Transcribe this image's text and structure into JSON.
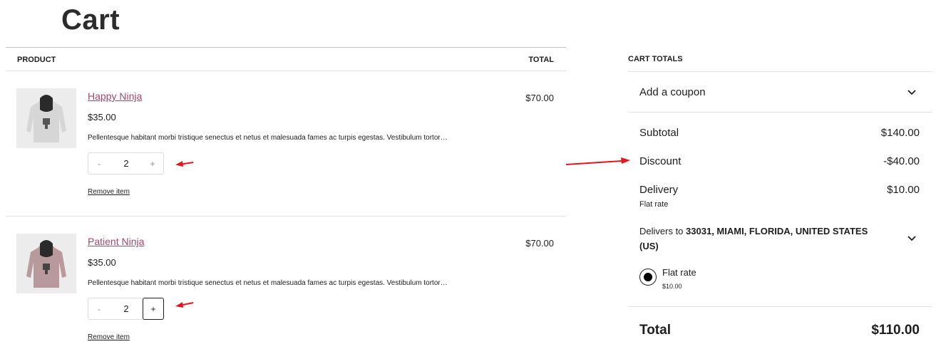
{
  "page": {
    "title": "Cart"
  },
  "cart_table": {
    "header_product": "PRODUCT",
    "header_total": "TOTAL",
    "items": [
      {
        "name": "Happy Ninja",
        "price": "$35.00",
        "description": "Pellentesque habitant morbi tristique senectus et netus et malesuada fames ac turpis egestas. Vestibulum tortor…",
        "quantity": "2",
        "minus_label": "-",
        "plus_label": "+",
        "line_total": "$70.00",
        "remove_label": "Remove item",
        "image_color": "#d6d6d6"
      },
      {
        "name": "Patient Ninja",
        "price": "$35.00",
        "description": "Pellentesque habitant morbi tristique senectus et netus et malesuada fames ac turpis egestas. Vestibulum tortor…",
        "quantity": "2",
        "minus_label": "-",
        "plus_label": "+",
        "line_total": "$70.00",
        "remove_label": "Remove item",
        "image_color": "#b89a9c"
      }
    ]
  },
  "cart_totals": {
    "heading": "CART TOTALS",
    "coupon_label": "Add a coupon",
    "subtotal_label": "Subtotal",
    "subtotal_value": "$140.00",
    "discount_label": "Discount",
    "discount_value": "-$40.00",
    "delivery_label": "Delivery",
    "delivery_value": "$10.00",
    "delivery_method": "Flat rate",
    "delivers_to_prefix": "Delivers to",
    "delivers_to_address": "33031, MIAMI, FLORIDA, UNITED STATES (US)",
    "shipping_option_label": "Flat rate",
    "shipping_option_price": "$10.00",
    "shipping_option_selected": true,
    "total_label": "Total",
    "total_value": "$110.00"
  },
  "colors": {
    "product_link": "#a3496c",
    "annotation_arrow": "#e8141b",
    "text": "#1e1e1e",
    "divider": "#e0e0e0"
  },
  "icons": [
    "chevron-down-icon",
    "hoodie-image",
    "radio-selected-icon",
    "annotation-arrow"
  ]
}
